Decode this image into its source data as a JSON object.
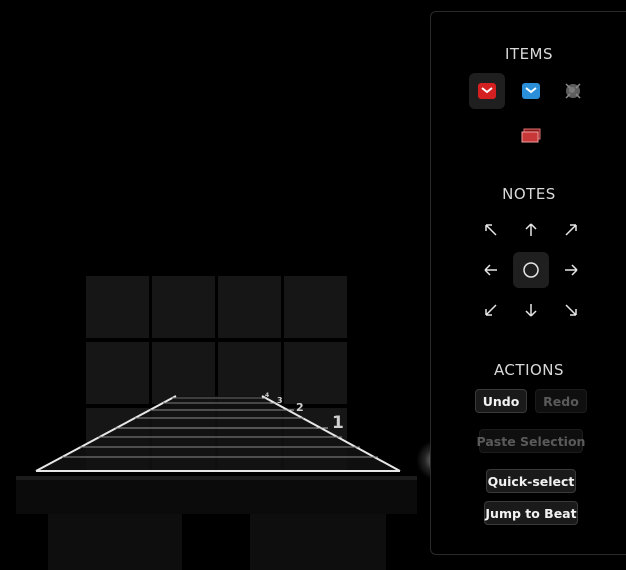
{
  "panel": {
    "items_title": "ITEMS",
    "notes_title": "NOTES",
    "actions_title": "ACTIONS",
    "items": [
      {
        "name": "red-block",
        "color": "#d42020",
        "selected": true
      },
      {
        "name": "blue-block",
        "color": "#2a8fd8",
        "selected": false
      },
      {
        "name": "bomb",
        "color": "#6a6a6a",
        "selected": false
      },
      {
        "name": "wall",
        "color": "#c83838",
        "selected": false
      }
    ],
    "notes": [
      {
        "name": "up-left",
        "glyph": "↖"
      },
      {
        "name": "up",
        "glyph": "↑"
      },
      {
        "name": "up-right",
        "glyph": "↗"
      },
      {
        "name": "left",
        "glyph": "←"
      },
      {
        "name": "dot",
        "glyph": "◯",
        "selected": true
      },
      {
        "name": "right",
        "glyph": "→"
      },
      {
        "name": "down-left",
        "glyph": "↙"
      },
      {
        "name": "down",
        "glyph": "↓"
      },
      {
        "name": "down-right",
        "glyph": "↘"
      }
    ],
    "actions": {
      "undo": "Undo",
      "redo": "Redo",
      "paste_selection": "Paste Selection",
      "quick_select": "Quick-select",
      "jump_to_beat": "Jump to Beat"
    }
  },
  "track": {
    "beat_labels": [
      "1",
      "2",
      "3",
      "4"
    ]
  }
}
